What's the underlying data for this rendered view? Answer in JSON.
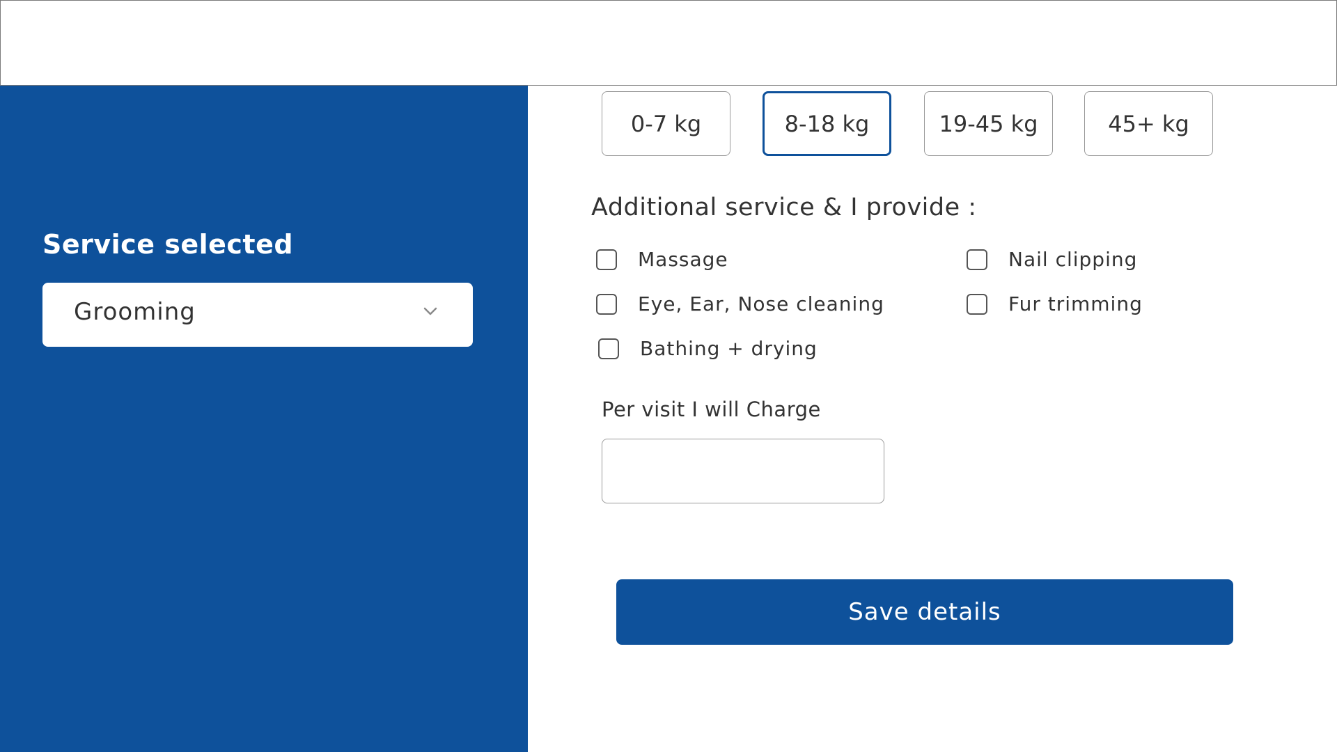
{
  "sidebar": {
    "service_title": "Service selected",
    "service_value": "Grooming"
  },
  "weights": [
    {
      "label": "0-7 kg",
      "selected": false
    },
    {
      "label": "8-18 kg",
      "selected": true
    },
    {
      "label": "19-45 kg",
      "selected": false
    },
    {
      "label": "45+ kg",
      "selected": false
    }
  ],
  "additional": {
    "heading": "Additional service & I provide :",
    "options": [
      {
        "label": "Massage",
        "checked": false
      },
      {
        "label": "Nail clipping",
        "checked": false
      },
      {
        "label": "Eye, Ear, Nose cleaning",
        "checked": false
      },
      {
        "label": "Fur trimming",
        "checked": false
      },
      {
        "label": "Bathing + drying",
        "checked": false
      }
    ]
  },
  "charge": {
    "label": "Per visit I will Charge",
    "value": ""
  },
  "actions": {
    "save_label": "Save details"
  },
  "colors": {
    "brand": "#0e519b"
  },
  "icons": {
    "dropdown": "chevron-down-icon"
  }
}
